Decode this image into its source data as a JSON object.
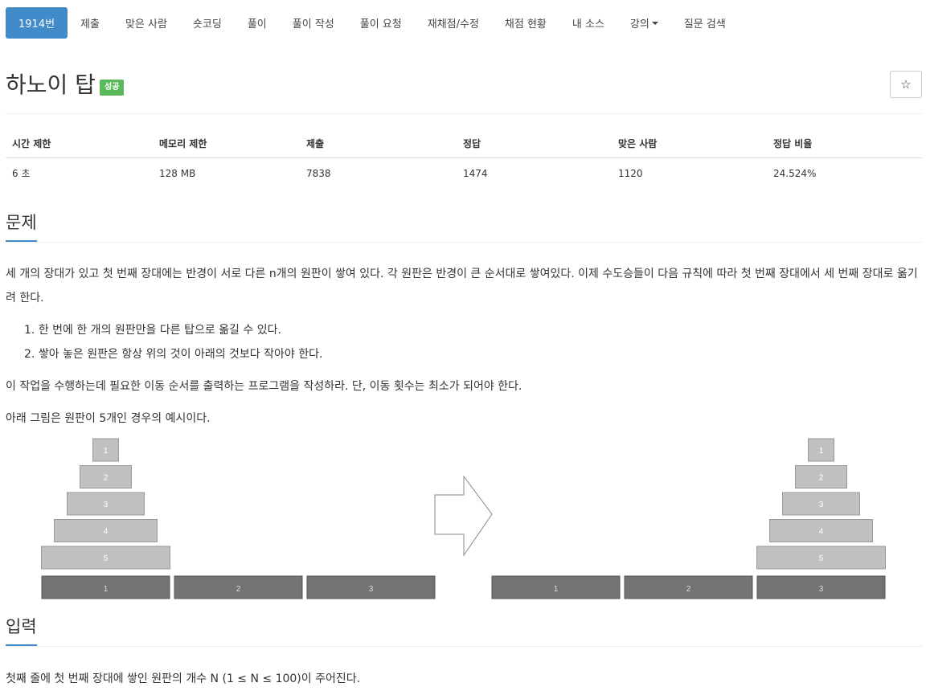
{
  "nav": {
    "items": [
      "1914번",
      "제출",
      "맞은 사람",
      "숏코딩",
      "풀이",
      "풀이 작성",
      "풀이 요청",
      "재채점/수정",
      "채점 현황",
      "내 소스",
      "강의",
      "질문 검색"
    ],
    "active_index": 0
  },
  "problem": {
    "title": "하노이 탑",
    "badge": "성공",
    "star_icon": "☆"
  },
  "stats": {
    "headers": [
      "시간 제한",
      "메모리 제한",
      "제출",
      "정답",
      "맞은 사람",
      "정답 비율"
    ],
    "values": [
      "6 초",
      "128 MB",
      "7838",
      "1474",
      "1120",
      "24.524%"
    ]
  },
  "sections": {
    "problem_heading": "문제",
    "input_heading": "입력"
  },
  "description": {
    "p1": "세 개의 장대가 있고 첫 번째 장대에는 반경이 서로 다른 n개의 원판이 쌓여 있다. 각 원판은 반경이 큰 순서대로 쌓여있다. 이제 수도승들이 다음 규칙에 따라 첫 번째 장대에서 세 번째 장대로 옮기려 한다.",
    "rules": [
      "한 번에 한 개의 원판만을 다른 탑으로 옮길 수 있다.",
      "쌓아 놓은 원판은 항상 위의 것이 아래의 것보다 작아야 한다."
    ],
    "p2": "이 작업을 수행하는데 필요한 이동 순서를 출력하는 프로그램을 작성하라. 단, 이동 횟수는 최소가 되어야 한다.",
    "p3": "아래 그림은 원판이 5개인 경우의 예시이다."
  },
  "figure": {
    "disk_labels": [
      "1",
      "2",
      "3",
      "4",
      "5"
    ],
    "peg_labels": [
      "1",
      "2",
      "3"
    ],
    "disk_color": "#c0c0c0",
    "peg_color": "#737373"
  },
  "input": {
    "text": "첫째 줄에 첫 번째 장대에 쌓인 원판의 개수 N (1 ≤ N ≤ 100)이 주어진다."
  }
}
